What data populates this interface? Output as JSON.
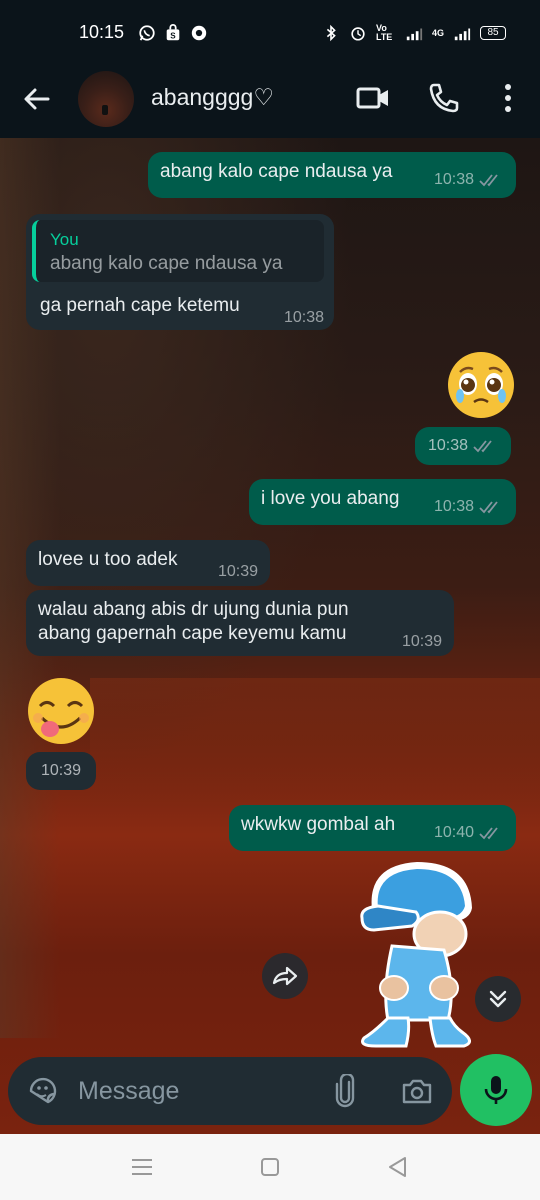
{
  "status_bar": {
    "time": "10:15",
    "volte_label": "Vo LTE",
    "network_label": "4G",
    "battery": "85"
  },
  "header": {
    "contact_name": "abangggg♡"
  },
  "messages": [
    {
      "id": "m1",
      "direction": "out",
      "text": "abang kalo cape ndausa ya",
      "time": "10:38"
    },
    {
      "id": "m2",
      "direction": "in",
      "quote_author": "You",
      "quote_text": "abang kalo cape ndausa ya",
      "text": "ga pernah cape ketemu",
      "time": "10:38"
    },
    {
      "id": "m3",
      "direction": "out",
      "emoji": "pleading-face",
      "time": "10:38"
    },
    {
      "id": "m4",
      "direction": "out",
      "text": "i love you abang",
      "time": "10:38"
    },
    {
      "id": "m5",
      "direction": "in",
      "text": "lovee u too adek",
      "time": "10:39"
    },
    {
      "id": "m6",
      "direction": "in",
      "line1": "walau abang abis dr ujung dunia pun",
      "line2": "abang gapernah cape keyemu kamu",
      "time": "10:39"
    },
    {
      "id": "m7",
      "direction": "in",
      "emoji": "face-savoring-food",
      "time": "10:39"
    },
    {
      "id": "m8",
      "direction": "out",
      "text": "wkwkw gombal ah",
      "time": "10:40"
    },
    {
      "id": "m9",
      "direction": "in",
      "sticker": "pocoyo-dancing-sticker"
    }
  ],
  "composer": {
    "placeholder": "Message"
  },
  "colors": {
    "outgoing_bubble": "#005c4b",
    "incoming_bubble": "#202c33",
    "accent": "#21c063",
    "read_ticks": "#8696a0"
  }
}
